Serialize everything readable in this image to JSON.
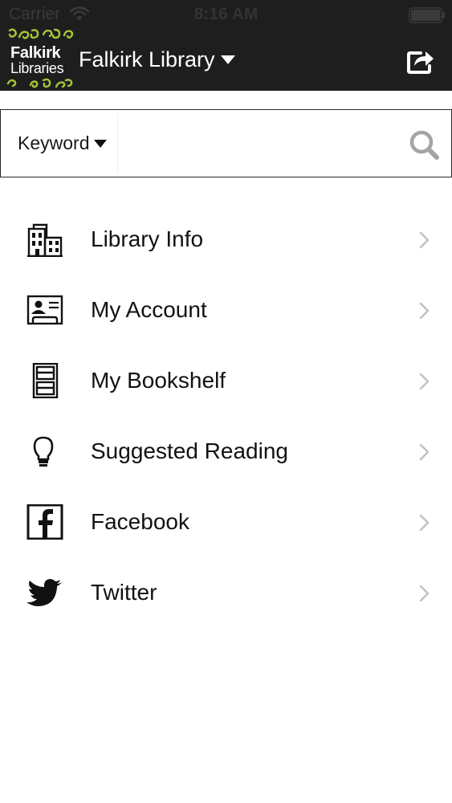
{
  "status_bar": {
    "carrier": "Carrier",
    "time": "8:16 AM"
  },
  "header": {
    "logo_line1": "Falkirk",
    "logo_line2": "Libraries",
    "title": "Falkirk Library",
    "background_color": "#1e1e1e",
    "logo_accent_color": "#a6c63a",
    "share_icon": "share-icon"
  },
  "search": {
    "scope_label": "Keyword",
    "placeholder": "",
    "value": "",
    "icon": "search-icon"
  },
  "menu": {
    "items": [
      {
        "label": "Library Info",
        "icon": "building-icon"
      },
      {
        "label": "My Account",
        "icon": "id-card-icon"
      },
      {
        "label": "My Bookshelf",
        "icon": "bookshelf-icon"
      },
      {
        "label": "Suggested Reading",
        "icon": "lightbulb-icon"
      },
      {
        "label": "Facebook",
        "icon": "facebook-icon"
      },
      {
        "label": "Twitter",
        "icon": "twitter-icon"
      }
    ],
    "chevron_icon": "chevron-right-icon"
  }
}
